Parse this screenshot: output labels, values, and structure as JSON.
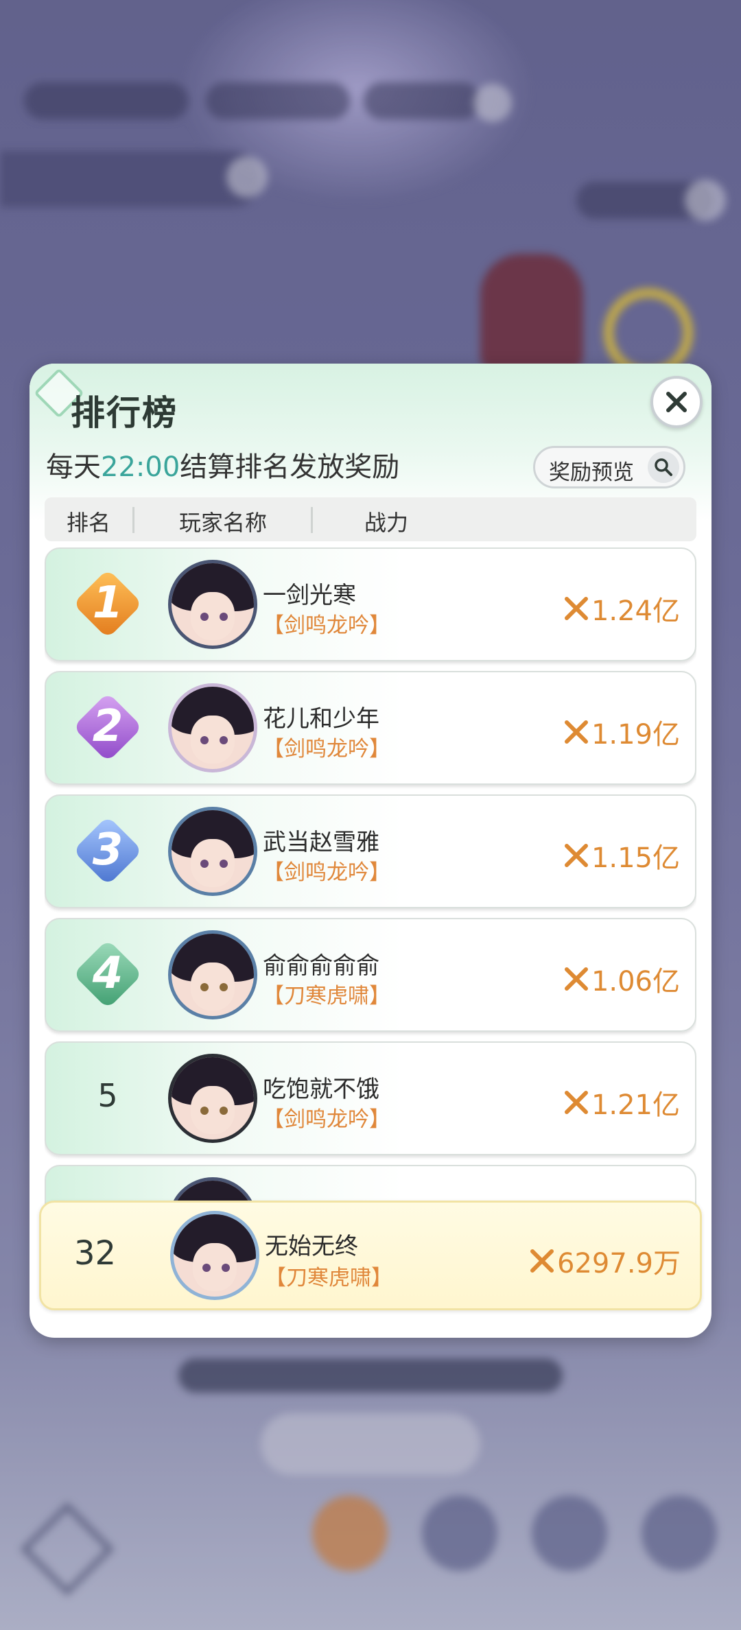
{
  "leaderboard": {
    "title": "排行榜",
    "subtitle_prefix": "每天",
    "subtitle_time": "22:00",
    "subtitle_suffix": "结算排名发放奖励",
    "reward_preview_label": "奖励预览",
    "columns": {
      "rank": "排名",
      "player": "玩家名称",
      "power": "战力"
    },
    "rows": [
      {
        "rank": "1",
        "name": "一剑光寒",
        "faction": "【剑鸣龙吟】",
        "power": "1.24亿",
        "badge_color": "#f0922c"
      },
      {
        "rank": "2",
        "name": "花儿和少年",
        "faction": "【剑鸣龙吟】",
        "power": "1.19亿",
        "badge_color": "#a965d8"
      },
      {
        "rank": "3",
        "name": "武当赵雪雅",
        "faction": "【剑鸣龙吟】",
        "power": "1.15亿",
        "badge_color": "#5a86d8"
      },
      {
        "rank": "4",
        "name": "俞俞俞俞俞",
        "faction": "【刀寒虎啸】",
        "power": "1.06亿",
        "badge_color": "#54b084"
      },
      {
        "rank": "5",
        "name": "吃饱就不饿",
        "faction": "【剑鸣龙吟】",
        "power": "1.21亿",
        "badge_color": null
      }
    ],
    "self": {
      "rank": "32",
      "name": "无始无终",
      "faction": "【刀寒虎啸】",
      "power": "6297.9万"
    }
  },
  "colors": {
    "accent_teal": "#3aa59b",
    "power_orange": "#de8a33",
    "faction_orange": "#e0873a"
  },
  "icons": {
    "close": "close-icon",
    "search": "search-icon",
    "power": "power-swords-icon"
  }
}
